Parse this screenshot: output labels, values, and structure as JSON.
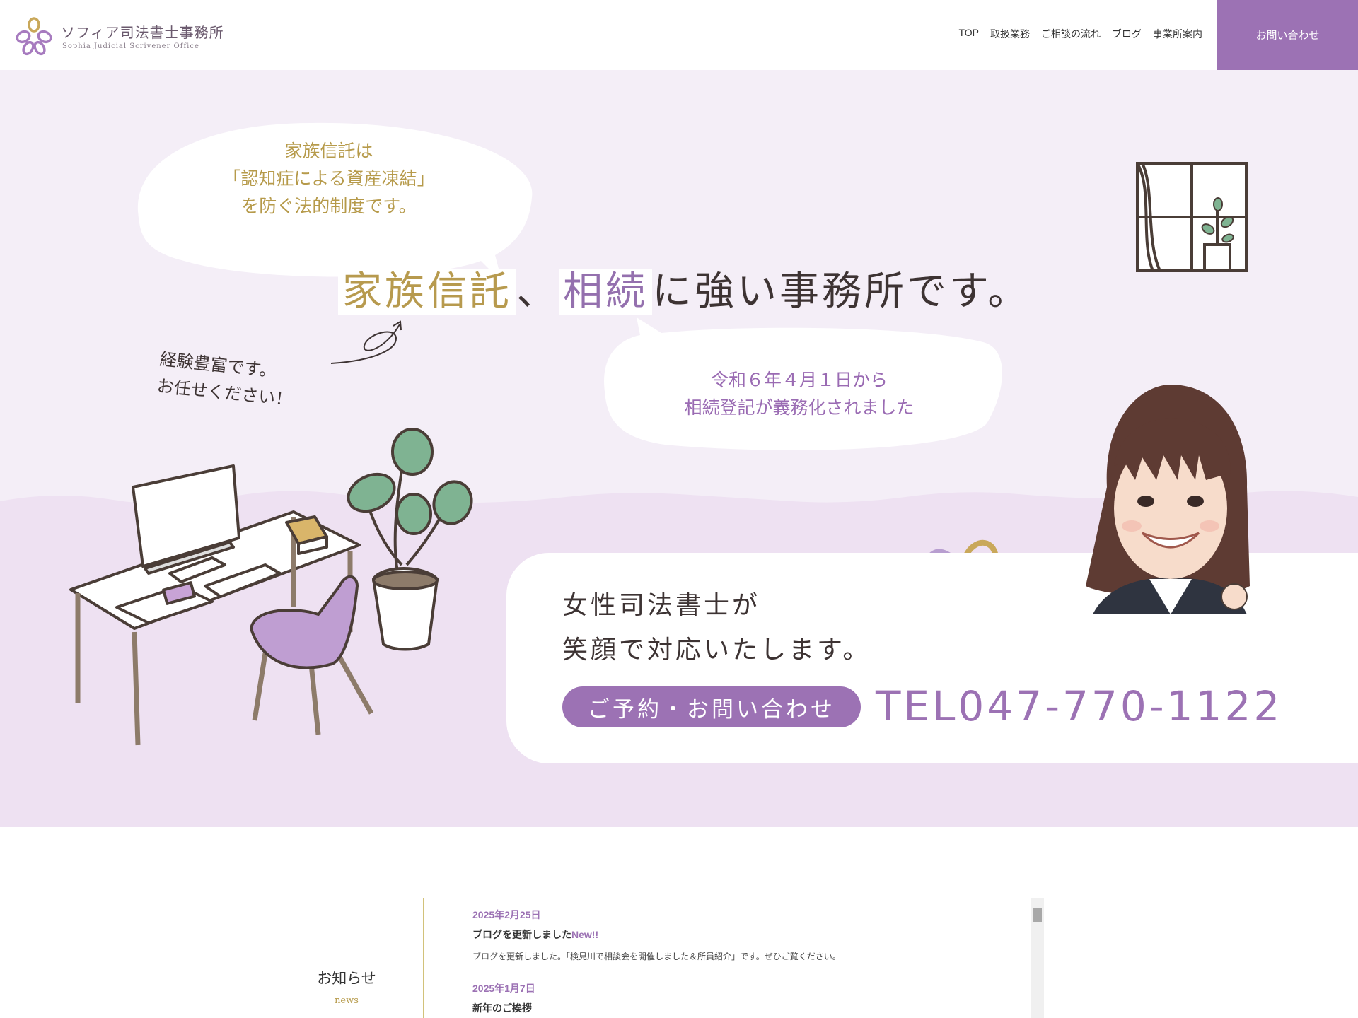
{
  "header": {
    "logo_jp": "ソフィア司法書士事務所",
    "logo_en": "Sophia Judicial Scrivener Office",
    "nav": [
      "TOP",
      "取扱業務",
      "ご相談の流れ",
      "ブログ",
      "事業所案内"
    ],
    "contact_label": "お問い合わせ"
  },
  "hero": {
    "bubble1": [
      "家族信託は",
      "「認知症による資産凍結」",
      "を防ぐ法的制度です。"
    ],
    "catch_hl1": "家族信託",
    "catch_sep": "、",
    "catch_hl2": "相続",
    "catch_rest": "に強い事務所です。",
    "experience": [
      "経験豊富です。",
      "お任せください！"
    ],
    "bubble2": [
      "令和６年４月１日から",
      "相続登記が義務化されました"
    ],
    "card_line1": "女性司法書士が",
    "card_line2": "笑顔で対応いたします。",
    "reserve_label": "ご予約・お問い合わせ",
    "tel": "TEL047-770-1122"
  },
  "news": {
    "title": "お知らせ",
    "subtitle": "news",
    "items": [
      {
        "date": "2025年2月25日",
        "headline": "ブログを更新しました",
        "new": "New!!",
        "body": "ブログを更新しました。「検見川で相談会を開催しました＆所員紹介」です。ぜひご覧ください。"
      },
      {
        "date": "2025年1月7日",
        "headline": "新年のご挨拶",
        "new": "",
        "body": ""
      }
    ]
  },
  "colors": {
    "accent_purple": "#9c72b4",
    "accent_gold": "#b69a4a",
    "hero_bg": "#f4eef7",
    "hero_lower_bg": "#eee1f2"
  }
}
